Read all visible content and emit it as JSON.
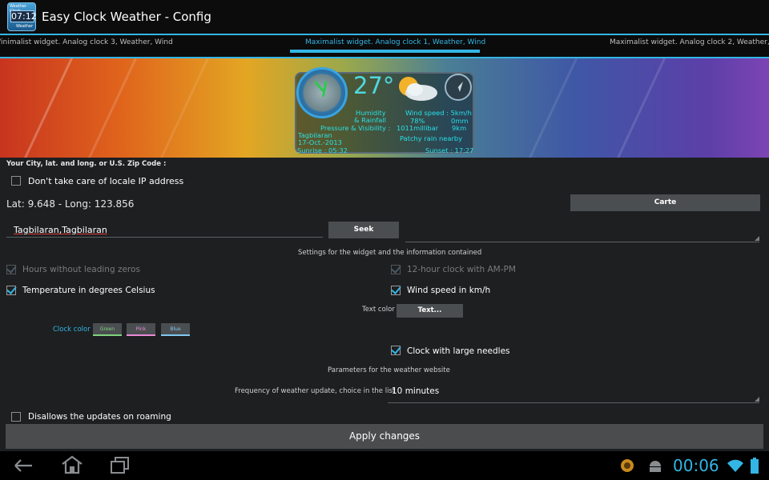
{
  "app": {
    "title": "Easy Clock Weather - Config",
    "icon_name": "app-icon",
    "icon_time": "07:12",
    "icon_caption_top": "Weather Clock",
    "icon_caption_bottom": "Weather"
  },
  "tabs": {
    "left": "/inimalist widget. Analog clock 3, Weather, Wind",
    "center": "Maximalist widget. Analog clock 1, Weather, Wind",
    "right": "Maximalist widget. Analog clock 2, Weather, Wind"
  },
  "widget": {
    "temperature": "27°",
    "humidity_label": "Humidity",
    "rainfall_label": "& Rainfall",
    "pressure_label": "Pressure & Visibility :",
    "wind_label": "Wind speed : 5km/h",
    "humidity_value": "78%",
    "rainfall_value": "0mm",
    "pressure_value": "1011millibar",
    "visibility_value": "9km",
    "city": "Tagbilaran",
    "date": "17-Oct.-2013",
    "condition": "Patchy rain nearby",
    "sunrise": "Sunrise : 05:32",
    "sunset": "Sunset : 17:27"
  },
  "location": {
    "section_label": "Your City, lat. and long. or U.S. Zip Code :",
    "ignore_ip_label": "Don't take care of locale IP address",
    "ignore_ip_checked": false,
    "latlong": "Lat: 9.648 - Long: 123.856",
    "map_button": "Carte",
    "city_value": "Tagbilaran,Tagbilaran",
    "seek_button": "Seek"
  },
  "settings": {
    "header": "Settings for the widget and the information contained",
    "hours_zeros_label": "Hours without leading zeros",
    "hours_zeros_checked": true,
    "hours_zeros_enabled": false,
    "ampm_label": "12-hour clock with AM-PM",
    "ampm_checked": true,
    "ampm_enabled": false,
    "celsius_label": "Temperature in degrees Celsius",
    "celsius_checked": true,
    "wind_kmh_label": "Wind speed in km/h",
    "wind_kmh_checked": true,
    "text_color_label": "Text color",
    "text_color_button": "Text...",
    "clock_color_label": "Clock color",
    "clock_colors": [
      {
        "label": "Green",
        "color": "#7fd37f"
      },
      {
        "label": "Pink",
        "color": "#e88ad8"
      },
      {
        "label": "Blue",
        "color": "#7fc8f0"
      }
    ],
    "large_needles_label": "Clock with large needles",
    "large_needles_checked": true
  },
  "weather_site": {
    "header": "Parameters for the weather website",
    "frequency_label": "Frequency of weather update, choice in the list",
    "frequency_value": "10 minutes",
    "roaming_label": "Disallows the updates on roaming",
    "roaming_checked": false
  },
  "apply_button": "Apply changes",
  "statusbar": {
    "time": "00:06",
    "icons": [
      "back-icon",
      "home-icon",
      "recent-apps-icon",
      "notification-icon",
      "android-icon",
      "wifi-icon",
      "battery-icon"
    ]
  },
  "colors": {
    "accent": "#33b5e5",
    "background": "#1d1f21",
    "widget_text": "#29e0e6"
  }
}
